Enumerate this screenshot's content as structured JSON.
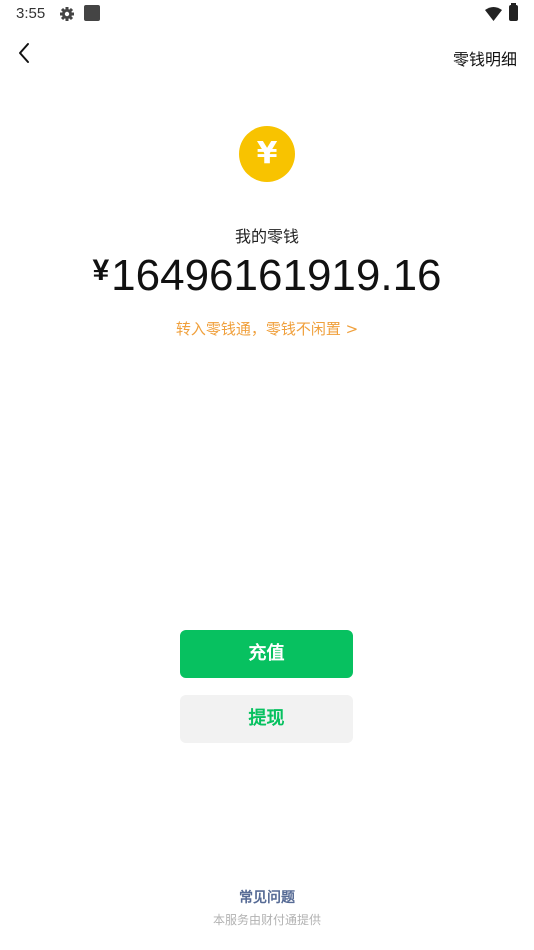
{
  "status_bar": {
    "time": "3:55",
    "icons": [
      "gear-icon",
      "square-notification-icon",
      "wifi-icon",
      "battery-icon"
    ]
  },
  "nav": {
    "back_icon": "chevron-left-icon",
    "details_label": "零钱明细"
  },
  "balance": {
    "coin_symbol": "¥",
    "label": "我的零钱",
    "currency": "¥",
    "amount": "16496161919.16",
    "promo_text": "转入零钱通，零钱不闲置 >"
  },
  "actions": {
    "recharge_label": "充值",
    "withdraw_label": "提现"
  },
  "footer": {
    "faq_label": "常见问题",
    "provider_note": "本服务由财付通提供"
  },
  "colors": {
    "accent_green": "#07c160",
    "coin_yellow": "#f8c300",
    "promo_orange": "#f0a03c",
    "link_blue": "#576b95"
  }
}
